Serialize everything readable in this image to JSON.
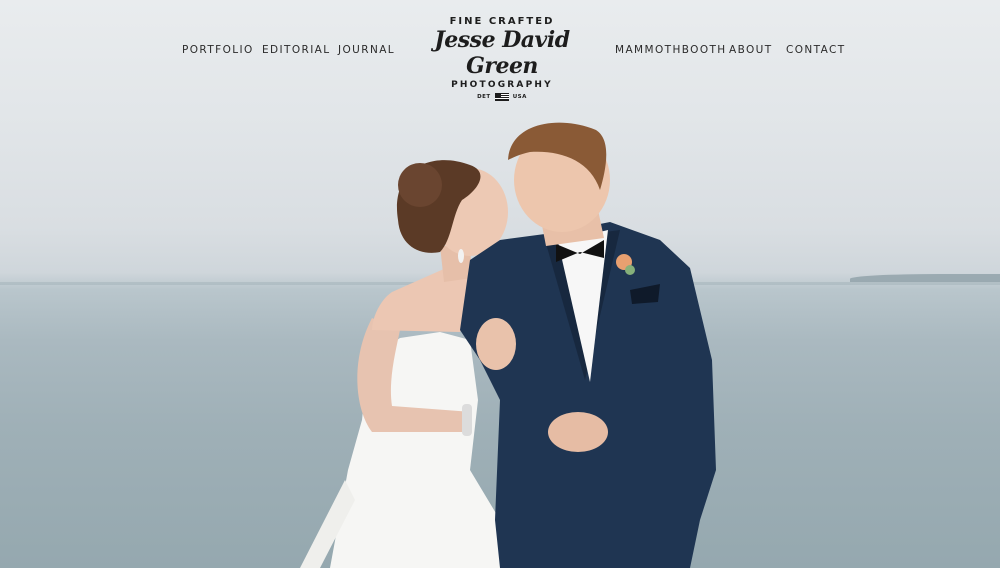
{
  "nav": {
    "left": [
      {
        "label": "PORTFOLIO"
      },
      {
        "label": "EDITORIAL"
      },
      {
        "label": "JOURNAL"
      }
    ],
    "right": [
      {
        "label": "MAMMOTHBOOTH"
      },
      {
        "label": "ABOUT"
      },
      {
        "label": "CONTACT"
      }
    ]
  },
  "logo": {
    "top": "FINE CRAFTED",
    "name": "Jesse David Green",
    "sub": "PHOTOGRAPHY",
    "loc_left": "DET",
    "loc_right": "USA",
    "flag_icon": "us-flag-icon"
  },
  "colors": {
    "nav_text": "#2b2b2b",
    "sky": "#e6e9eb",
    "water": "#9fb0b7",
    "suit": "#1f3552"
  }
}
